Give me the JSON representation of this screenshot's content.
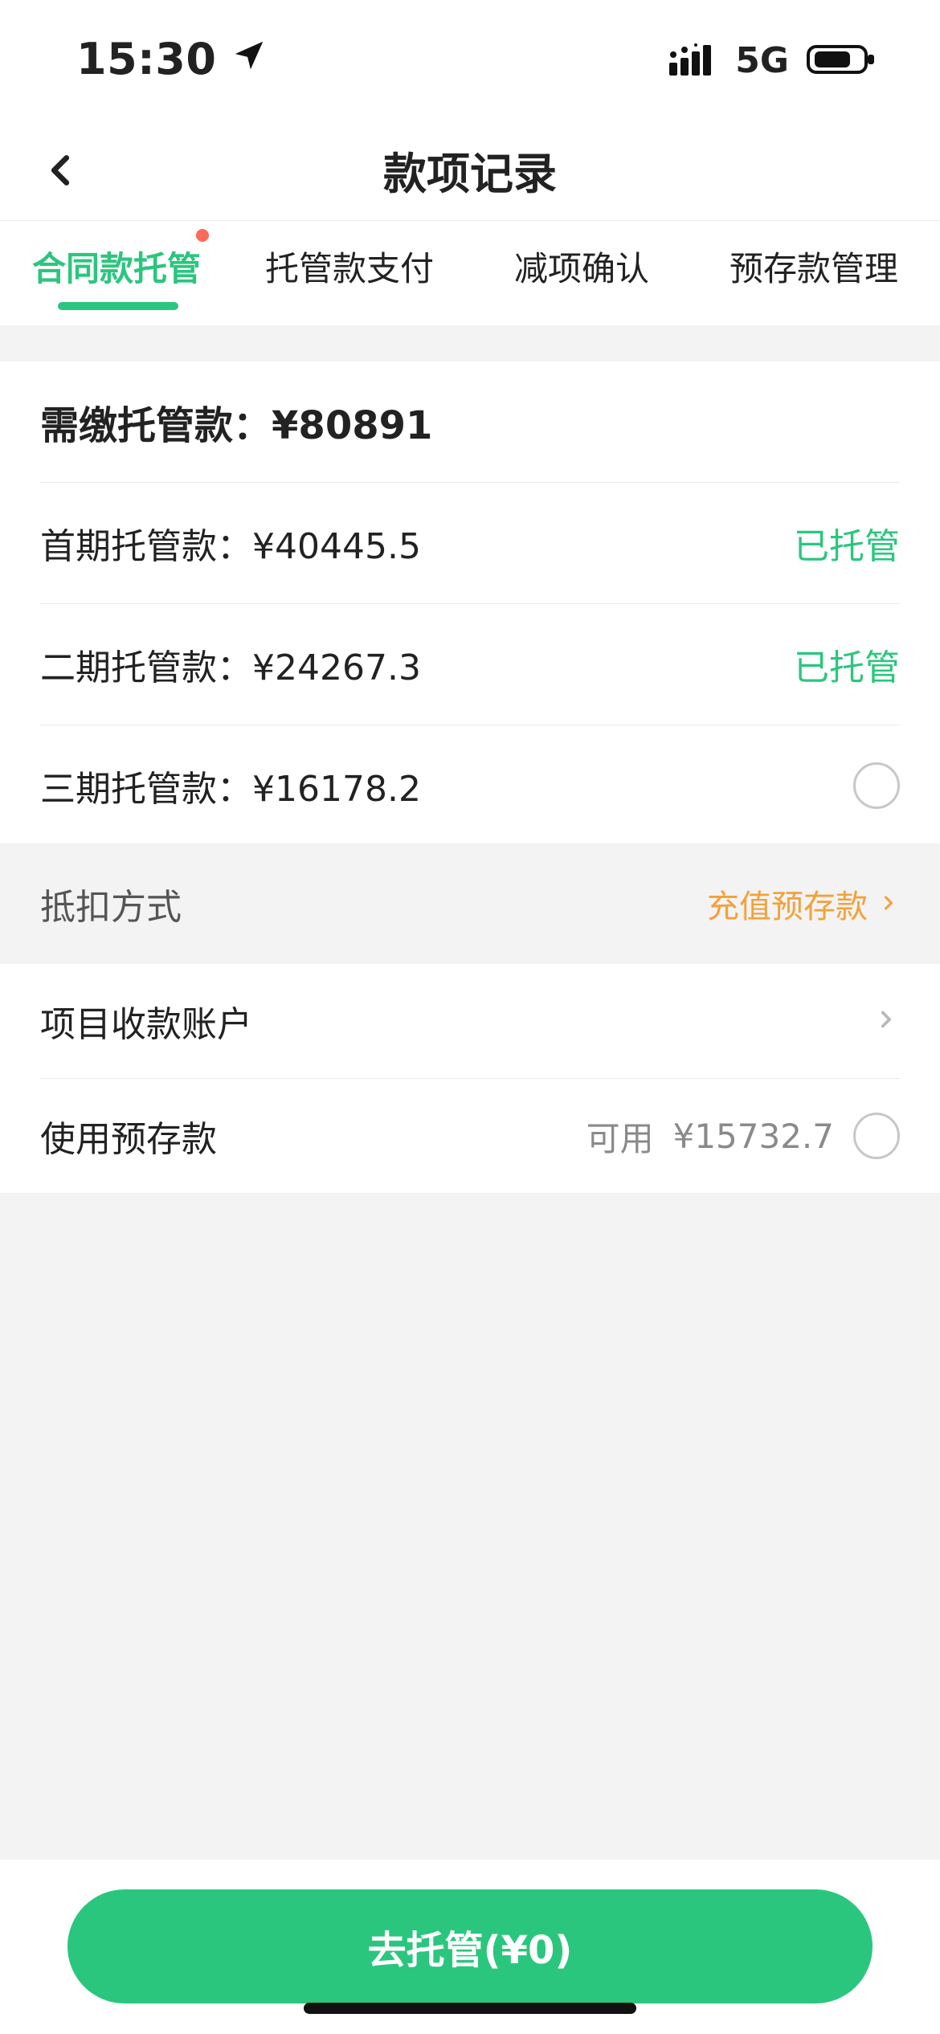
{
  "status_bar": {
    "time": "15:30",
    "network": "5G",
    "icons": [
      "location-arrow-icon",
      "signal-bars-icon",
      "battery-icon"
    ]
  },
  "nav": {
    "title": "款项记录",
    "back_icon": "back-arrow-icon"
  },
  "tabs": [
    {
      "label": "合同款托管",
      "active": true,
      "has_dot": true
    },
    {
      "label": "托管款支付",
      "active": false
    },
    {
      "label": "减项确认",
      "active": false
    },
    {
      "label": "预存款管理",
      "active": false
    }
  ],
  "custody": {
    "required_label": "需缴托管款：",
    "required_amount": "¥80891",
    "items": [
      {
        "label": "首期托管款：",
        "amount": "¥40445.5",
        "status": "已托管"
      },
      {
        "label": "二期托管款：",
        "amount": "¥24267.3",
        "status": "已托管"
      },
      {
        "label": "三期托管款：",
        "amount": "¥16178.2",
        "status": ""
      }
    ]
  },
  "deduction": {
    "label": "抵扣方式",
    "link_label": "充值预存款"
  },
  "payment_account": {
    "label": "项目收款账户"
  },
  "use_prepaid": {
    "label": "使用预存款",
    "available_label": "可用",
    "available_amount": "¥15732.7"
  },
  "cta": {
    "label": "去托管(¥0)"
  },
  "colors": {
    "primary": "#2BC67E",
    "link": "#F2A23A",
    "dot": "#FF6A5B"
  }
}
